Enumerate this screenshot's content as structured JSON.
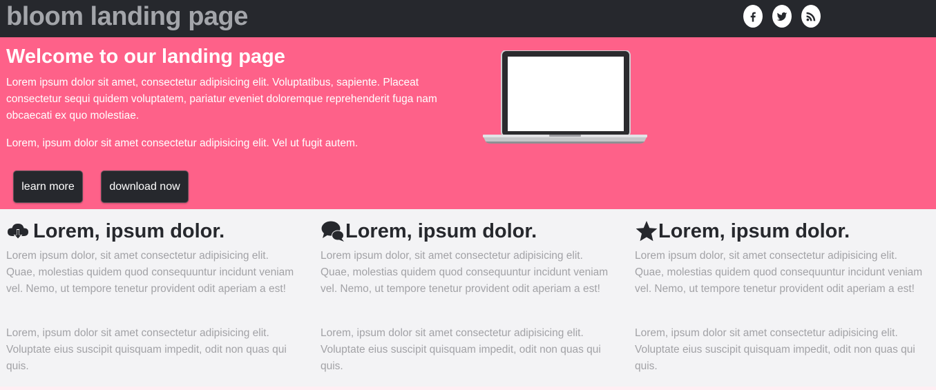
{
  "header": {
    "brand": "bloom landing page",
    "social_icons": [
      "facebook-icon",
      "twitter-icon",
      "rss-icon"
    ]
  },
  "hero": {
    "title": "Welcome to our landing page",
    "paragraph_1": "Lorem ipsum dolor sit amet, consectetur adipisicing elit. Voluptatibus, sapiente. Placeat consectetur sequi quidem voluptatem, pariatur eveniet doloremque reprehenderit fuga nam obcaecati ex quo molestiae.",
    "paragraph_2": "Lorem, ipsum dolor sit amet consectetur adipisicing elit. Vel ut fugit autem.",
    "learn_more_label": "learn more",
    "download_label": "download now",
    "image_icon": "laptop-icon"
  },
  "features": [
    {
      "icon": "cloud-download-icon",
      "title": "Lorem, ipsum dolor.",
      "paragraph_1": "Lorem ipsum dolor, sit amet consectetur adipisicing elit. Quae, molestias quidem quod consequuntur incidunt veniam vel. Nemo, ut tempore tenetur provident odit aperiam a est!",
      "paragraph_2": "Lorem, ipsum dolor sit amet consectetur adipisicing elit. Voluptate eius suscipit quisquam impedit, odit non quas qui quis."
    },
    {
      "icon": "comments-icon",
      "title": "Lorem, ipsum dolor.",
      "paragraph_1": "Lorem ipsum dolor, sit amet consectetur adipisicing elit. Quae, molestias quidem quod consequuntur incidunt veniam vel. Nemo, ut tempore tenetur provident odit aperiam a est!",
      "paragraph_2": "Lorem, ipsum dolor sit amet consectetur adipisicing elit. Voluptate eius suscipit quisquam impedit, odit non quas qui quis."
    },
    {
      "icon": "star-icon",
      "title": "Lorem, ipsum dolor.",
      "paragraph_1": "Lorem ipsum dolor, sit amet consectetur adipisicing elit. Quae, molestias quidem quod consequuntur incidunt veniam vel. Nemo, ut tempore tenetur provident odit aperiam a est!",
      "paragraph_2": "Lorem, ipsum dolor sit amet consectetur adipisicing elit. Voluptate eius suscipit quisquam impedit, odit non quas qui quis."
    }
  ],
  "colors": {
    "header_bg": "#26282d",
    "brand_text": "#a3a5aa",
    "hero_bg": "#fe6189",
    "features_bg": "#f3f3f5",
    "body_text_muted": "#a2a2a6"
  }
}
